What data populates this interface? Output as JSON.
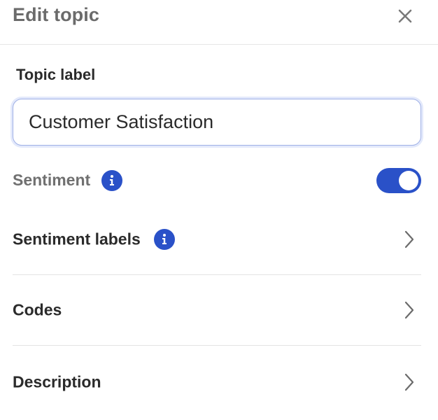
{
  "header": {
    "title": "Edit topic"
  },
  "topic_label": {
    "label": "Topic label",
    "value": "Customer Satisfaction"
  },
  "sentiment": {
    "label": "Sentiment",
    "enabled": true
  },
  "rows": [
    {
      "label": "Sentiment labels",
      "has_info": true
    },
    {
      "label": "Codes",
      "has_info": false
    },
    {
      "label": "Description",
      "has_info": false
    }
  ],
  "colors": {
    "accent": "#2a51c8",
    "title_gray": "#6b6b6b",
    "text": "#2b2b2b",
    "divider": "#e3e3e3",
    "input_focus_border": "#9fb0e6"
  },
  "icons": {
    "close": "close-icon",
    "info": "info-icon",
    "chevron": "chevron-right-icon"
  }
}
